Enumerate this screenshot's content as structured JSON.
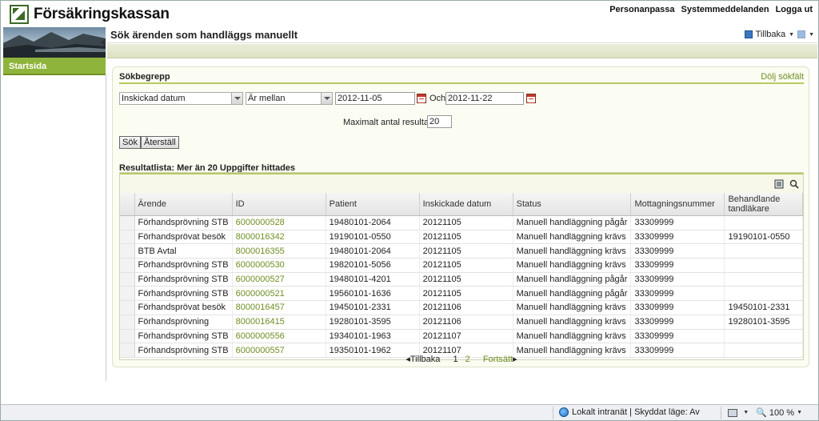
{
  "header": {
    "brand": "Försäkringskassan",
    "links": [
      "Personanpassa",
      "Systemmeddelanden",
      "Logga ut"
    ]
  },
  "nav": {
    "start": "Startsida"
  },
  "title": {
    "text": "Sök ärenden som handläggs manuellt",
    "back": "Tillbaka"
  },
  "search": {
    "heading": "Sökbegrepp",
    "hide": "Dölj sökfält",
    "field": "Inskickad datum",
    "operator": "Är mellan",
    "from": "2012-11-05",
    "and": "Och",
    "to": "2012-11-22",
    "max_label": "Maximalt antal resultat:",
    "max_value": "20",
    "search_btn": "Sök",
    "reset_btn": "Återställ"
  },
  "results": {
    "heading": "Resultatlista: Mer än 20 Uppgifter hittades",
    "columns": [
      "Ärende",
      "ID",
      "Patient",
      "Inskickade datum",
      "Status",
      "Mottagningsnummer",
      "Behandlande tandläkare"
    ],
    "rows": [
      [
        "Förhandsprövning STB",
        "6000000528",
        "19480101-2064",
        "20121105",
        "Manuell handläggning pågår",
        "33309999",
        ""
      ],
      [
        "Förhandsprövat besök",
        "8000016342",
        "19190101-0550",
        "20121105",
        "Manuell handläggning krävs",
        "33309999",
        "19190101-0550"
      ],
      [
        "BTB Avtal",
        "8000016355",
        "19480101-2064",
        "20121105",
        "Manuell handläggning krävs",
        "33309999",
        ""
      ],
      [
        "Förhandsprövning STB",
        "6000000530",
        "19820101-5056",
        "20121105",
        "Manuell handläggning krävs",
        "33309999",
        ""
      ],
      [
        "Förhandsprövning STB",
        "6000000527",
        "19480101-4201",
        "20121105",
        "Manuell handläggning pågår",
        "33309999",
        ""
      ],
      [
        "Förhandsprövning STB",
        "6000000521",
        "19560101-1636",
        "20121105",
        "Manuell handläggning pågår",
        "33309999",
        ""
      ],
      [
        "Förhandsprövat besök",
        "8000016457",
        "19450101-2331",
        "20121106",
        "Manuell handläggning krävs",
        "33309999",
        "19450101-2331"
      ],
      [
        "Förhandsprövning",
        "8000016415",
        "19280101-3595",
        "20121106",
        "Manuell handläggning krävs",
        "33309999",
        "19280101-3595"
      ],
      [
        "Förhandsprövning STB",
        "6000000556",
        "19340101-1963",
        "20121107",
        "Manuell handläggning krävs",
        "33309999",
        ""
      ],
      [
        "Förhandsprövning STB",
        "6000000557",
        "19350101-1962",
        "20121107",
        "Manuell handläggning krävs",
        "33309999",
        ""
      ]
    ]
  },
  "pager": {
    "prev": "Tillbaka",
    "p1": "1",
    "p2": "2",
    "next": "Fortsätt"
  },
  "status": {
    "zone": "Lokalt intranät | Skyddat läge: Av",
    "zoom": "100 %"
  },
  "colors": {
    "accent": "#8fb43b",
    "link": "#6f8f25"
  }
}
